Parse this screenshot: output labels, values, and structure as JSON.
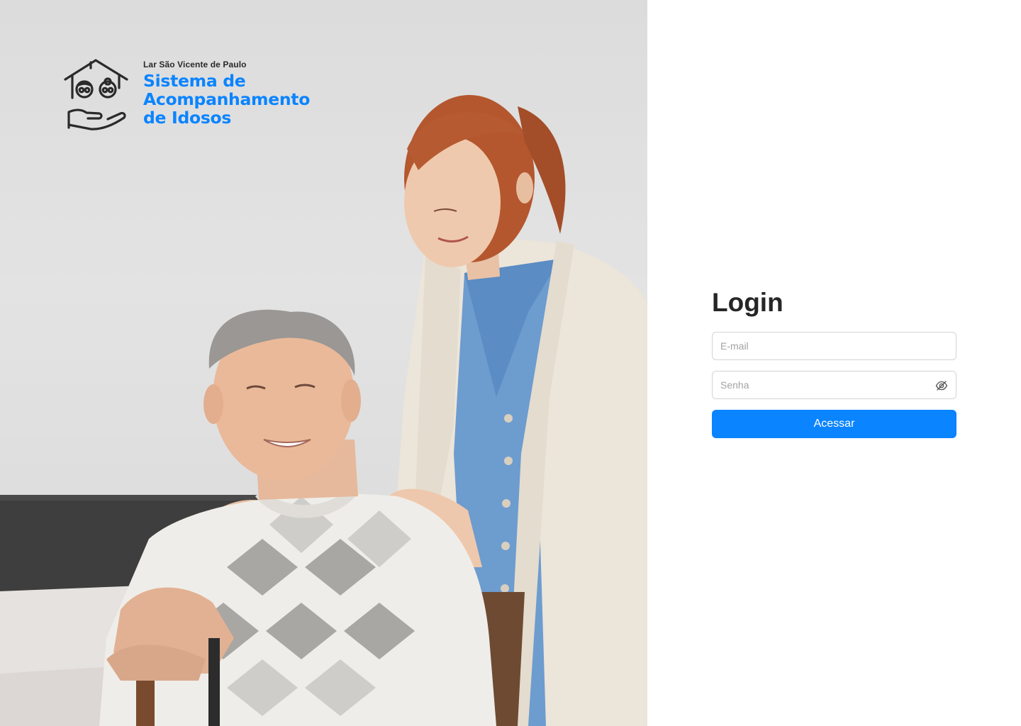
{
  "brand": {
    "org": "Lar São Vicente de Paulo",
    "title_lines": [
      "Sistema de",
      "Acompanhamento",
      "de Idosos"
    ],
    "accent_color": "#0a84ff",
    "logo_icon": "house-hand-icon"
  },
  "hero": {
    "photo": "caregiver-with-elderly-man-photo"
  },
  "login": {
    "title": "Login",
    "email": {
      "placeholder": "E-mail",
      "value": ""
    },
    "password": {
      "placeholder": "Senha",
      "value": "",
      "toggle_icon": "eye-off-icon"
    },
    "submit_label": "Acessar",
    "button_color": "#0a84ff"
  }
}
